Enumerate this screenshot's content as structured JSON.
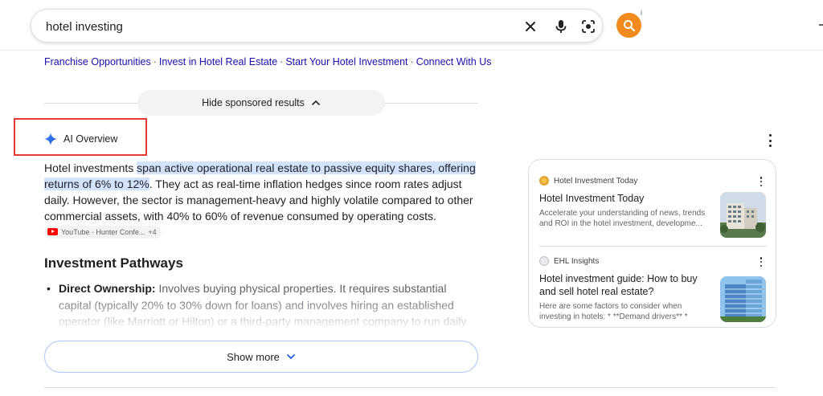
{
  "search": {
    "query": "hotel investing",
    "info_mark": "i"
  },
  "sitelinks": [
    "Franchise Opportunities",
    "Invest in Hotel Real Estate",
    "Start Your Hotel Investment",
    "Connect With Us"
  ],
  "sitelink_separator": "·",
  "sponsored": {
    "hide_label": "Hide sponsored results"
  },
  "ai_overview": {
    "label": "AI Overview",
    "summary_intro": "Hotel investments ",
    "summary_highlight": "span active operational real estate to passive equity shares, offering returns of 6% to 12%",
    "summary_rest": ". They act as real-time inflation hedges since room rates adjust daily. However, the sector is management-heavy and highly volatile compared to other commercial assets, with 40% to 60% of revenue consumed by operating costs.",
    "source_chip": {
      "text": "YouTube · Hunter Confe...",
      "count": "+4"
    },
    "section_heading": "Investment Pathways",
    "bullets": [
      {
        "title": "Direct Ownership:",
        "text": " Involves buying physical properties. It requires substantial capital (typically 20% to 30% down for loans) and involves hiring an established operator (like Marriott or Hilton) or a third-party management company to run daily operations."
      }
    ],
    "show_more": "Show more"
  },
  "sources": [
    {
      "site": "Hotel Investment Today",
      "title": "Hotel Investment Today",
      "snippet": "Accelerate your understanding of news, trends and ROI in the hotel investment, developme..."
    },
    {
      "site": "EHL Insights",
      "title": "Hotel investment guide: How to buy and sell hotel real estate?",
      "snippet": "Here are some factors to consider when investing in hotels: * **Demand drivers** *"
    }
  ],
  "colors": {
    "accent_orange": "#f28b1e",
    "link_blue": "#1a0dab",
    "highlight_blue": "#d3e3fd",
    "annotation_red": "#e53935"
  },
  "icons": [
    "clear-icon",
    "mic-icon",
    "lens-icon",
    "search-icon",
    "chevron-up-icon",
    "sparkle-icon",
    "kebab-icon",
    "youtube-icon",
    "chevron-down-icon"
  ]
}
